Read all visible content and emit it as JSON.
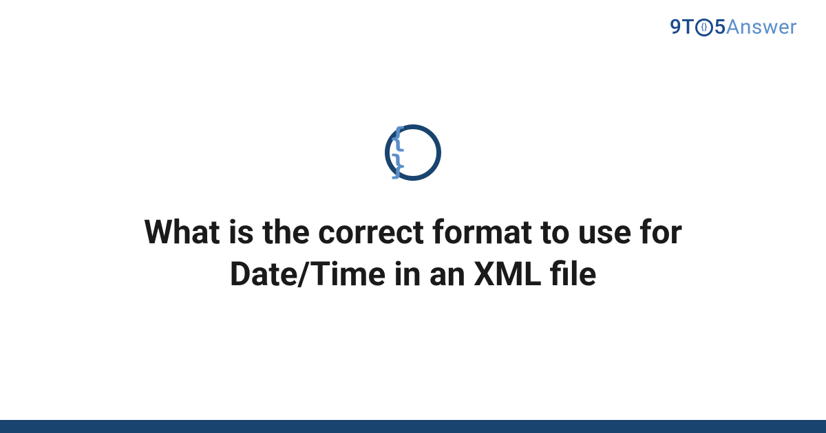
{
  "logo": {
    "part1": "9T",
    "o_inner": "{}",
    "part2": "5",
    "part3": "Answer"
  },
  "icon": {
    "glyph": "{ }",
    "name": "code-braces-icon"
  },
  "title": "What is the correct format to use for Date/Time in an XML file",
  "colors": {
    "brand_dark": "#19446f",
    "brand_mid": "#1b4a8a",
    "brand_light": "#5b8fc9"
  }
}
